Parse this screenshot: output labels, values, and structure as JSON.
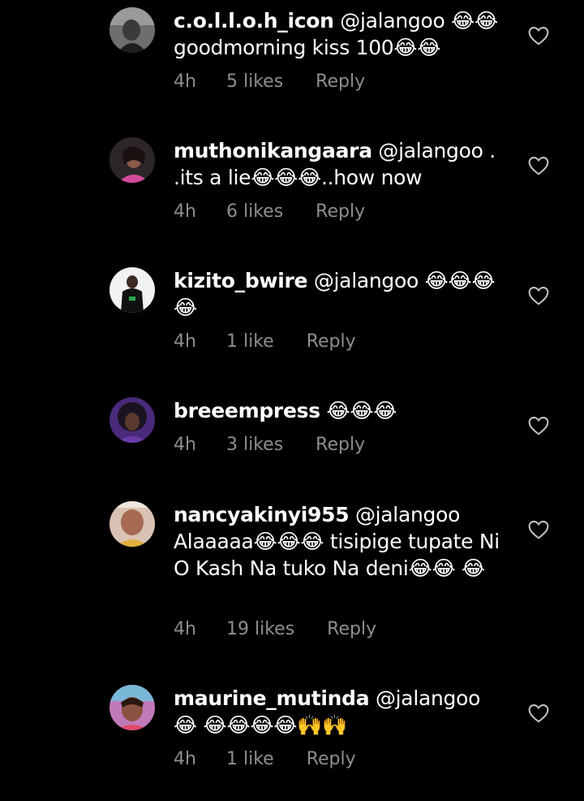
{
  "comments": [
    {
      "username": "c.o.l.l.o.h_icon",
      "text": " @jalangoo 😂😂 goodmorning kiss 100😂😂",
      "time": "4h",
      "likes": "5 likes",
      "reply": "Reply"
    },
    {
      "username": "muthonikangaara",
      "text": " @jalangoo . .its a lie😂😂😂..how now",
      "time": "4h",
      "likes": "6 likes",
      "reply": "Reply"
    },
    {
      "username": "kizito_bwire",
      "text": " @jalangoo 😂😂😂 😂",
      "time": "4h",
      "likes": "1 like",
      "reply": "Reply"
    },
    {
      "username": "breeempress",
      "text": " 😂😂😂",
      "time": "4h",
      "likes": "3 likes",
      "reply": "Reply"
    },
    {
      "username": "nancyakinyi955",
      "text": " @jalangoo Alaaaaa😂😂😂 tisipige tupate Ni O Kash Na tuko Na deni😂😂 😂",
      "time": "4h",
      "likes": "19 likes",
      "reply": "Reply"
    },
    {
      "username": "maurine_mutinda",
      "text": " @jalangoo 😂 😂😂😂😂🙌🙌",
      "time": "4h",
      "likes": "1 like",
      "reply": "Reply"
    }
  ],
  "colors": {
    "background": "#000000",
    "text": "#ffffff",
    "meta": "#8e8e8e",
    "heart": "#c7c7c7"
  },
  "icons": {
    "like": "heart-outline-icon",
    "avatar": "user-avatar"
  }
}
